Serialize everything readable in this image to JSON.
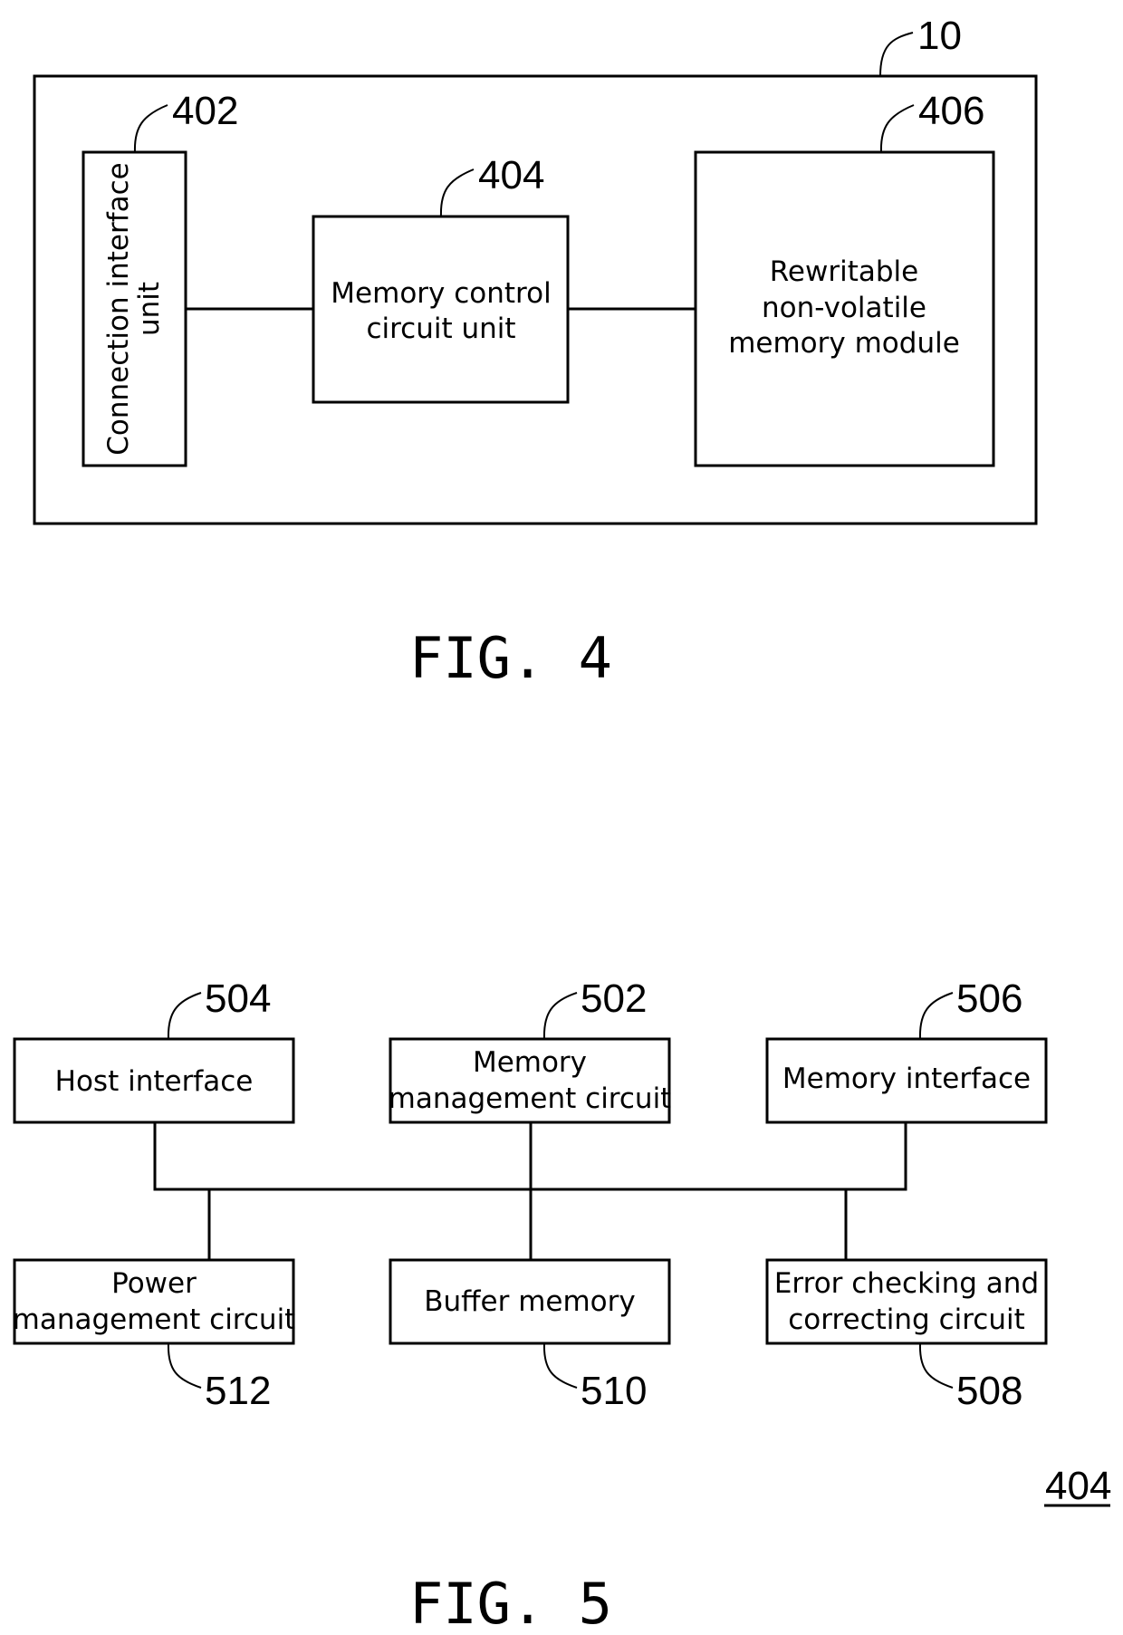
{
  "fig4": {
    "caption": "FIG. 4",
    "device": {
      "ref": "10"
    },
    "connection_interface": {
      "ref": "402",
      "lines": [
        "Connection interface",
        "unit"
      ]
    },
    "memory_control": {
      "ref": "404",
      "lines": [
        "Memory control",
        "circuit unit"
      ]
    },
    "rewritable_memory": {
      "ref": "406",
      "lines": [
        "Rewritable",
        "non-volatile",
        "memory module"
      ]
    }
  },
  "fig5": {
    "caption": "FIG. 5",
    "figure_ref": "404",
    "host_interface": {
      "ref": "504",
      "lines": [
        "Host interface"
      ]
    },
    "memory_management": {
      "ref": "502",
      "lines": [
        "Memory",
        "management circuit"
      ]
    },
    "memory_interface": {
      "ref": "506",
      "lines": [
        "Memory interface"
      ]
    },
    "power_management": {
      "ref": "512",
      "lines": [
        "Power",
        "management circuit"
      ]
    },
    "buffer_memory": {
      "ref": "510",
      "lines": [
        "Buffer memory"
      ]
    },
    "ecc_circuit": {
      "ref": "508",
      "lines": [
        "Error checking and",
        "correcting circuit"
      ]
    }
  }
}
